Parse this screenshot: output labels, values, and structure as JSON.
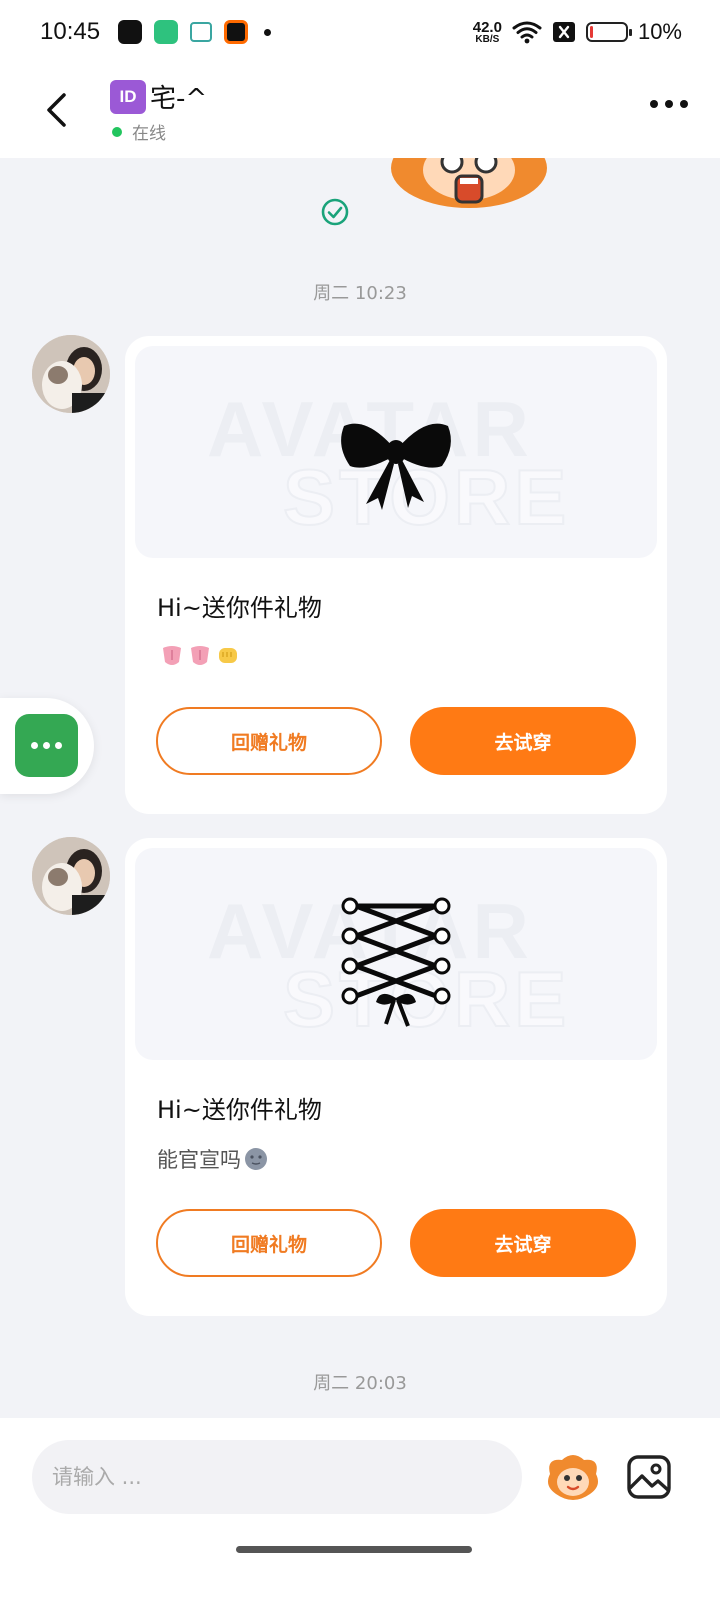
{
  "status_bar": {
    "time": "10:45",
    "speed_value": "42.0",
    "speed_unit": "KB/S",
    "battery_percent": "10%",
    "battery_level": 0.1,
    "battery_color": "#e53935"
  },
  "header": {
    "id_badge": "ID",
    "title": "宅-^",
    "status": "在线",
    "status_color": "#22c55e"
  },
  "messages": [
    {
      "time": "周二 10:23",
      "watermark_line1": "AVATAR",
      "watermark_line2": "STORE",
      "title": "Hi~送你件礼物",
      "gift_icon": "black-bow-icon",
      "emojis": [
        "tongue-emoji",
        "tongue-emoji",
        "fist-bump-emoji"
      ],
      "text": "",
      "return_gift_label": "回赠礼物",
      "try_on_label": "去试穿"
    },
    {
      "watermark_line1": "AVATAR",
      "watermark_line2": "STORE",
      "title": "Hi~送你件礼物",
      "gift_icon": "lace-up-corset-icon",
      "text": "能官宣吗",
      "emojis": [
        "new-moon-face-emoji"
      ],
      "return_gift_label": "回赠礼物",
      "try_on_label": "去试穿"
    }
  ],
  "bottom_time": "周二 20:03",
  "input": {
    "placeholder": "请输入 ..."
  },
  "colors": {
    "accent": "#ff7a14",
    "outline": "#f07b22",
    "float_button": "#34a853"
  }
}
